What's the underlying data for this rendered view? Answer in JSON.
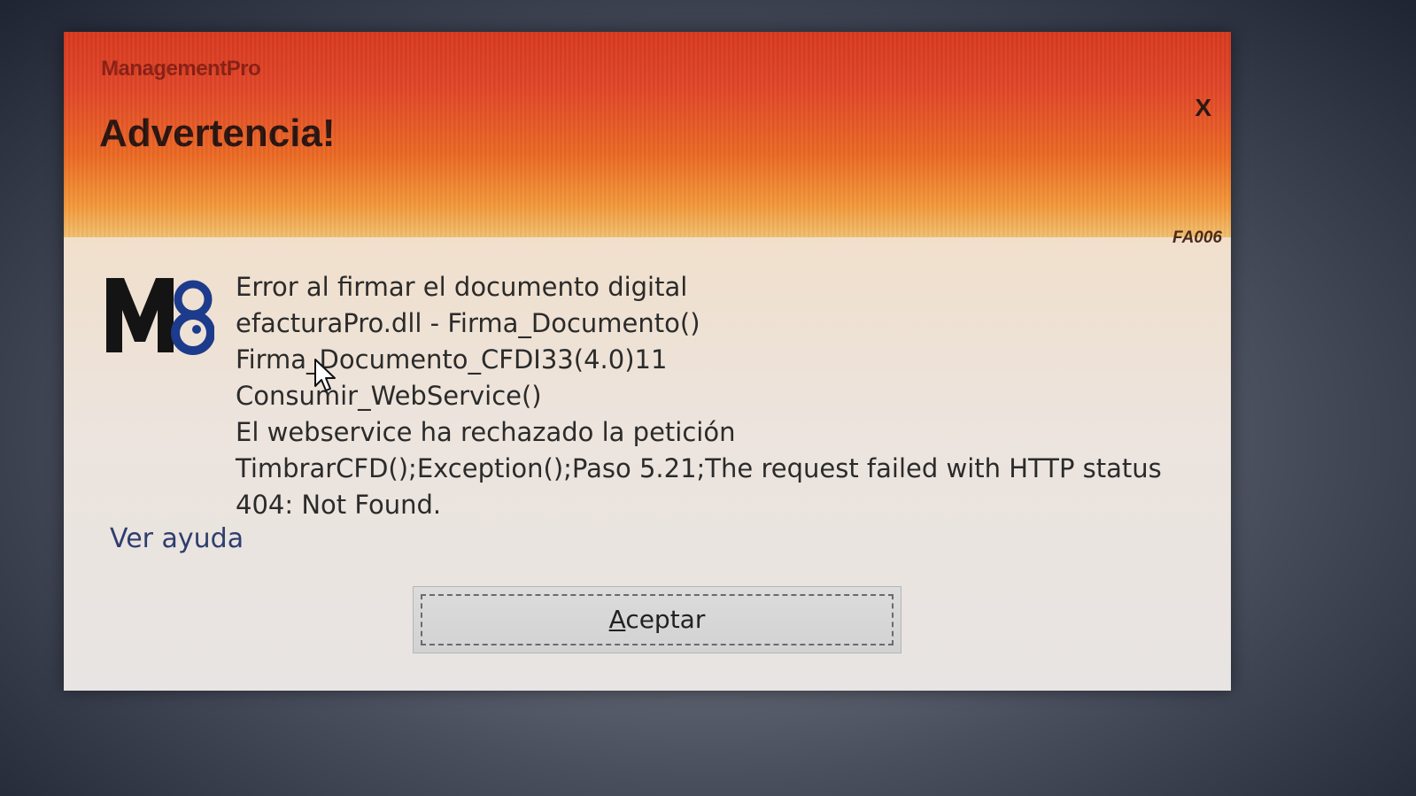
{
  "dialog": {
    "app_name": "ManagementPro",
    "title": "Advertencia!",
    "close_label": "X",
    "code": "FA006",
    "logo_text": "M8",
    "message_lines": [
      "Error al firmar el documento digital",
      "efacturaPro.dll - Firma_Documento()",
      "Firma_Documento_CFDI33(4.0)11",
      "Consumir_WebService()",
      "El webservice ha rechazado la petición",
      "TimbrarCFD();Exception();Paso 5.21;The request failed with HTTP status",
      "404: Not Found."
    ],
    "help_link": "Ver ayuda",
    "accept_button": "Aceptar"
  },
  "colors": {
    "header_red": "#d93a1f",
    "header_orange": "#ec6a24",
    "link_blue": "#2e3e6e",
    "logo_blue": "#1d3b8c"
  }
}
